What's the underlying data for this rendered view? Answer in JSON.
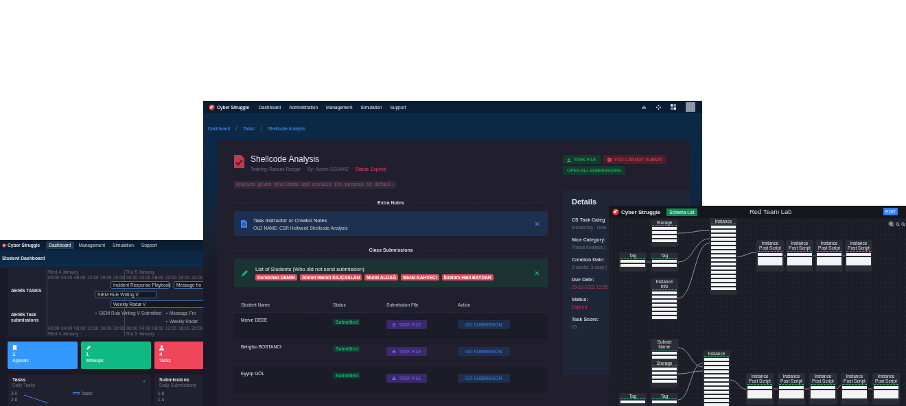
{
  "dashboard_window": {
    "brand": "Cyber Struggle",
    "nav": [
      {
        "label": "Dashboard",
        "selected": true
      },
      {
        "label": "Management",
        "selected": false
      },
      {
        "label": "Simulation",
        "selected": false
      },
      {
        "label": "Support",
        "selected": false
      }
    ],
    "heading": "Student Dashboard",
    "timeline": {
      "rows": [
        "AEGIS TASKS",
        "AEGIS Task submissions"
      ],
      "axis_top": {
        "dates": [
          "Wed 4 January",
          "Thu 5 January"
        ],
        "hours": [
          "00:00",
          "04:00",
          "08:00",
          "12:00",
          "16:00",
          "20:00",
          "00:00",
          "04:00",
          "08:00",
          "12:00",
          "16:00",
          "20:00"
        ]
      },
      "axis_bottom": {
        "dates": [
          "Wed 4 January",
          "Thu 5 January"
        ],
        "hours": [
          "00:00",
          "04:00",
          "08:00",
          "12:00",
          "16:00",
          "20:00",
          "00:00",
          "04:00",
          "08:00",
          "12:00",
          "16:00",
          "20:00"
        ]
      },
      "tasks": [
        "Incident Response Playbook",
        "Message fro",
        "SIEM Rule Writing V",
        "Weekly Radar V"
      ],
      "submissions": [
        "SIEM Rule Writing V Submitted",
        "Message Fro",
        "Weekly Radar"
      ]
    },
    "stats": [
      {
        "value": "1",
        "label": "Appeals",
        "kind": "bookmark",
        "color": "#3399ff"
      },
      {
        "value": "1",
        "label": "Writeups",
        "kind": "pencil",
        "color": "#10b981"
      },
      {
        "value": "4",
        "label": "Tasks",
        "kind": "user",
        "color": "#f0465a"
      }
    ],
    "panels": [
      {
        "title": "Tasks",
        "subtitle": "Daily Tasks",
        "legend": "Tasks",
        "ticks": [
          "3.0",
          "2.6"
        ]
      },
      {
        "title": "Submissions",
        "subtitle": "Daily Submissions",
        "ticks": [
          "1.6",
          "1.4"
        ]
      }
    ]
  },
  "main_window": {
    "brand": "Cyber Struggle",
    "nav": [
      {
        "label": "Dashboard"
      },
      {
        "label": "Administration"
      },
      {
        "label": "Management"
      },
      {
        "label": "Simulation"
      },
      {
        "label": "Support"
      }
    ],
    "breadcrumb": [
      "Dashboard",
      "Tasks",
      "Shellcode Analysis"
    ],
    "task": {
      "title": "Shellcode Analysis",
      "training": "Training: Ravens Ranger",
      "author": "By: Kerem SOLMAZ",
      "status": "Status: Expired",
      "description": "Analyze given shellcode and explain its purpose in detail."
    },
    "actions": [
      {
        "label": "TASK FILE",
        "kind": "download"
      },
      {
        "label": "YOU CANNOT SUBMIT",
        "kind": "blocked"
      },
      {
        "label": "OPEN ALL SUBMISSIONS",
        "kind": "plain"
      }
    ],
    "extra_notes": {
      "heading": "Extra Notes",
      "title": "Task Instructor or Creator Notes",
      "text": "OLD NAME: CSR Hellweek Shellcode Analysis"
    },
    "class_submissions": {
      "heading": "Class Submissions",
      "title": "List of Students (Who did not send submission)",
      "students": [
        "Deminhan DEMIR",
        "Ahmet Hamdi KILIÇASLAN",
        "Murat ALDAĞ",
        "Murat KAHVECI",
        "İbrahim Halil BAYDAR"
      ]
    },
    "table": {
      "columns": [
        "Student Name",
        "Status",
        "Submission File",
        "Action"
      ],
      "rows": [
        {
          "name": "Merve DEDE",
          "status": "Submitted",
          "file": "TASK FILE",
          "action": "GO SUBMISSION"
        },
        {
          "name": "Bengisu BOSTANCI",
          "status": "Submitted",
          "file": "TASK FILE",
          "action": "GO SUBMISSION"
        },
        {
          "name": "Eyyüp GÖL",
          "status": "Submitted",
          "file": "TASK FILE",
          "action": "GO SUBMISSION"
        }
      ]
    },
    "details": {
      "title": "Details",
      "fields": [
        {
          "label": "CS Task Categ",
          "value": "Monitoring - Dete",
          "alert": false
        },
        {
          "label": "Nice Category:",
          "value": "Threat Analysis (",
          "alert": false
        },
        {
          "label": "Creation Date:",
          "value": "3 weeks, 3 days (",
          "alert": false
        },
        {
          "label": "Due Date:",
          "value": "19-12-2022 13:35",
          "alert": true
        },
        {
          "label": "Status:",
          "value": "Expired",
          "alert": true
        },
        {
          "label": "Task Score:",
          "value": "15",
          "alert": false
        }
      ]
    }
  },
  "lab_window": {
    "brand": "Cyber Struggle",
    "schema_button": "Schema List",
    "title": "Red Team Lab",
    "edit_button": "EDIT",
    "nodes": [
      "Storage",
      "Tag",
      "Tag",
      "Instance Info",
      "Instance",
      "Instance Post Script",
      "Instance Post Script",
      "Instance Post Script",
      "Instance Post Script",
      "Subnet Name",
      "Storage",
      "Tag",
      "Tag",
      "Instance",
      "Instance Post Script",
      "Instance Post Script",
      "Instance Post Script",
      "Instance Post Script",
      "Instance Post Script"
    ]
  }
}
